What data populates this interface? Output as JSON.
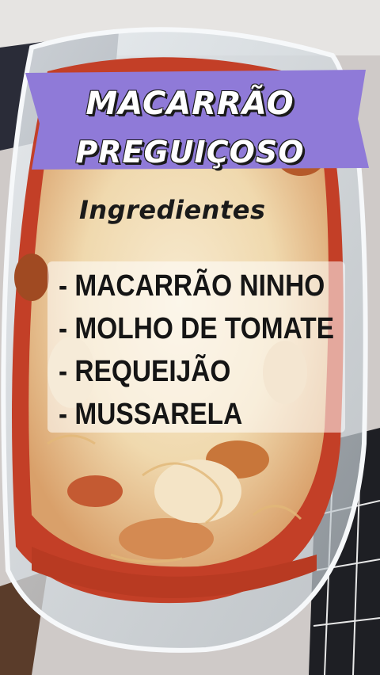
{
  "overlay": {
    "title_line1": "MACARRÃO",
    "title_line2": "PREGUIÇOSO",
    "ingredients_title": "Ingredientes",
    "ingredients": [
      "- MACARRÃO NINHO",
      "- MOLHO DE TOMATE",
      "- REQUEIJÃO",
      "- MUSSARELA"
    ]
  },
  "colors": {
    "banner": "#8f7ad8",
    "sauce": "#c9442a",
    "cheese": "#f1e0bd"
  }
}
